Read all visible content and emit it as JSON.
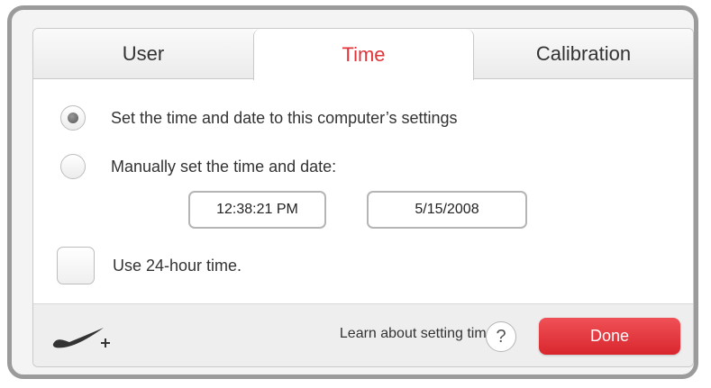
{
  "tabs": [
    {
      "label": "User",
      "active": false
    },
    {
      "label": "Time",
      "active": true
    },
    {
      "label": "Calibration",
      "active": false
    }
  ],
  "options": {
    "computer_time": {
      "label": "Set the time and date to this computer’s settings",
      "selected": true
    },
    "manual_time": {
      "label": "Manually set the time and date:",
      "selected": false
    },
    "time_value": "12:38:21 PM",
    "date_value": "5/15/2008",
    "use_24_hour": {
      "label": "Use 24-hour time.",
      "checked": false
    }
  },
  "footer": {
    "logo_icon": "nike-plus-swoosh-icon",
    "learn_text": "Learn about setting time.",
    "help_label": "?",
    "done_label": "Done"
  },
  "colors": {
    "accent": "#e0343b",
    "done_button": "#e0363c",
    "frame": "#9b9b9b",
    "text": "#333333"
  }
}
